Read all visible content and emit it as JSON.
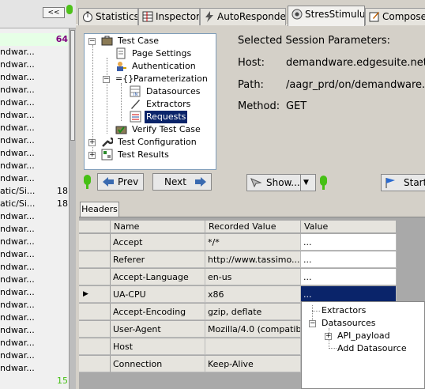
{
  "left_panel": {
    "toggle_label": "<<",
    "rows": [
      {
        "name": "",
        "count": "64",
        "highlight": true
      },
      {
        "name": "ndwar...",
        "count": ""
      },
      {
        "name": "ndwar...",
        "count": ""
      },
      {
        "name": "ndwar...",
        "count": ""
      },
      {
        "name": "ndwar...",
        "count": ""
      },
      {
        "name": "ndwar...",
        "count": ""
      },
      {
        "name": "ndwar...",
        "count": ""
      },
      {
        "name": "ndwar...",
        "count": ""
      },
      {
        "name": "ndwar...",
        "count": ""
      },
      {
        "name": "ndwar...",
        "count": ""
      },
      {
        "name": "ndwar...",
        "count": ""
      },
      {
        "name": "ndwar...",
        "count": ""
      },
      {
        "name": "atic/Si...",
        "count": "18"
      },
      {
        "name": "atic/Si...",
        "count": "18"
      },
      {
        "name": "ndwar...",
        "count": ""
      },
      {
        "name": "ndwar...",
        "count": ""
      },
      {
        "name": "ndwar...",
        "count": ""
      },
      {
        "name": "ndwar...",
        "count": ""
      },
      {
        "name": "ndwar...",
        "count": ""
      },
      {
        "name": "ndwar...",
        "count": ""
      },
      {
        "name": "ndwar...",
        "count": ""
      },
      {
        "name": "ndwar...",
        "count": ""
      },
      {
        "name": "ndwar...",
        "count": ""
      },
      {
        "name": "ndwar...",
        "count": ""
      },
      {
        "name": "ndwar...",
        "count": ""
      },
      {
        "name": "ndwar...",
        "count": ""
      },
      {
        "name": "ndwar...",
        "count": ""
      },
      {
        "name": "",
        "count": "15"
      }
    ]
  },
  "tabs": [
    {
      "label": "Statistics",
      "icon": "stopwatch-icon"
    },
    {
      "label": "Inspectors",
      "icon": "inspectors-grid-icon"
    },
    {
      "label": "AutoResponder",
      "icon": "lightning-icon"
    },
    {
      "label": "StresStimulus",
      "icon": "stress-stimulus-icon",
      "active": true
    },
    {
      "label": "Composer",
      "icon": "composer-icon"
    }
  ],
  "tree": {
    "test_case": "Test Case",
    "page_settings": "Page Settings",
    "authentication": "Authentication",
    "parameterization": "Parameterization",
    "parameterization_prefix": "={}",
    "datasources": "Datasources",
    "extractors": "Extractors",
    "requests": "Requests",
    "verify_test_case": "Verify Test Case",
    "test_configuration": "Test Configuration",
    "test_results": "Test Results"
  },
  "nav": {
    "prev": "Prev",
    "next": "Next"
  },
  "session": {
    "title": "Selected Session Parameters:",
    "host_label": "Host:",
    "host_value": "demandware.edgesuite.net",
    "path_label": "Path:",
    "path_value": "/aagr_prd/on/demandware.sta",
    "method_label": "Method:",
    "method_value": "GET"
  },
  "toolbar": {
    "show_label": "Show...",
    "start_label": "Start"
  },
  "headers_tab": "Headers",
  "grid": {
    "columns": [
      "Name",
      "Recorded Value",
      "Value"
    ],
    "rows": [
      {
        "name": "Accept",
        "recorded": "*/*",
        "value": "..."
      },
      {
        "name": "Referer",
        "recorded": "http://www.tassimo...",
        "value": "..."
      },
      {
        "name": "Accept-Language",
        "recorded": "en-us",
        "value": "..."
      },
      {
        "name": "UA-CPU",
        "recorded": "x86",
        "value": "...",
        "selected": true
      },
      {
        "name": "Accept-Encoding",
        "recorded": "gzip, deflate",
        "value": ""
      },
      {
        "name": "User-Agent",
        "recorded": "Mozilla/4.0 (compatib...",
        "value": ""
      },
      {
        "name": "Host",
        "recorded": "",
        "value": ""
      },
      {
        "name": "Connection",
        "recorded": "Keep-Alive",
        "value": ""
      }
    ]
  },
  "popup": {
    "extractors": "Extractors",
    "datasources": "Datasources",
    "api_payload": "API_payload",
    "add_datasource": "Add Datasource"
  },
  "colors": {
    "selection": "#0a246a",
    "status_green": "#46c015",
    "count_purple": "#800080"
  }
}
